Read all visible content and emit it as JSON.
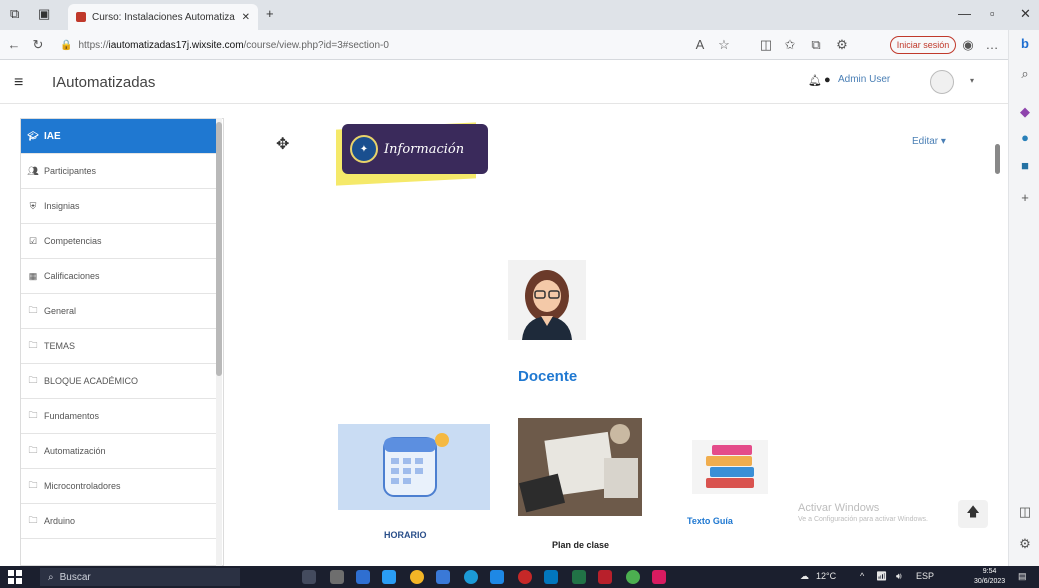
{
  "browser": {
    "tab_title": "Curso: Instalaciones Automatiza",
    "url_prefix": "https://",
    "url_domain": "iautomatizadas17j.wixsite.com",
    "url_path": "/course/view.php?id=3#section-0",
    "signin_label": "Iniciar sesión"
  },
  "navbar": {
    "site_name": "IAutomatizadas",
    "user_name": "Admin User"
  },
  "drawer": {
    "items": [
      {
        "label": "IAE",
        "icon": "graduation-icon"
      },
      {
        "label": "Participantes",
        "icon": "users-icon"
      },
      {
        "label": "Insignias",
        "icon": "shield-icon"
      },
      {
        "label": "Competencias",
        "icon": "checkbox-icon"
      },
      {
        "label": "Calificaciones",
        "icon": "table-icon"
      },
      {
        "label": "General",
        "icon": "folder-icon"
      },
      {
        "label": "TEMAS",
        "icon": "folder-icon"
      },
      {
        "label": "BLOQUE ACADÉMICO",
        "icon": "folder-icon"
      },
      {
        "label": "Fundamentos",
        "icon": "folder-icon"
      },
      {
        "label": "Automatización",
        "icon": "folder-icon"
      },
      {
        "label": "Microcontroladores",
        "icon": "folder-icon"
      },
      {
        "label": "Arduino",
        "icon": "folder-icon"
      }
    ]
  },
  "main": {
    "edit_label": "Editar ▾",
    "info_banner_text": "Información",
    "teacher_label": "Docente",
    "horario_label": "HORARIO",
    "plan_label": "Plan de clase",
    "texto_label": "Texto Guía"
  },
  "watermark": {
    "line1": "Activar Windows",
    "line2": "Ve a Configuración para activar Windows."
  },
  "taskbar": {
    "search_label": "Buscar",
    "temperature": "12°C",
    "time": "9:54",
    "date": "30/6/2023"
  },
  "colors": {
    "accent": "#1f78d1",
    "taskbar": "#1b1f2e",
    "banner": "#3a2a5b",
    "highlight": "#f5e96a"
  }
}
